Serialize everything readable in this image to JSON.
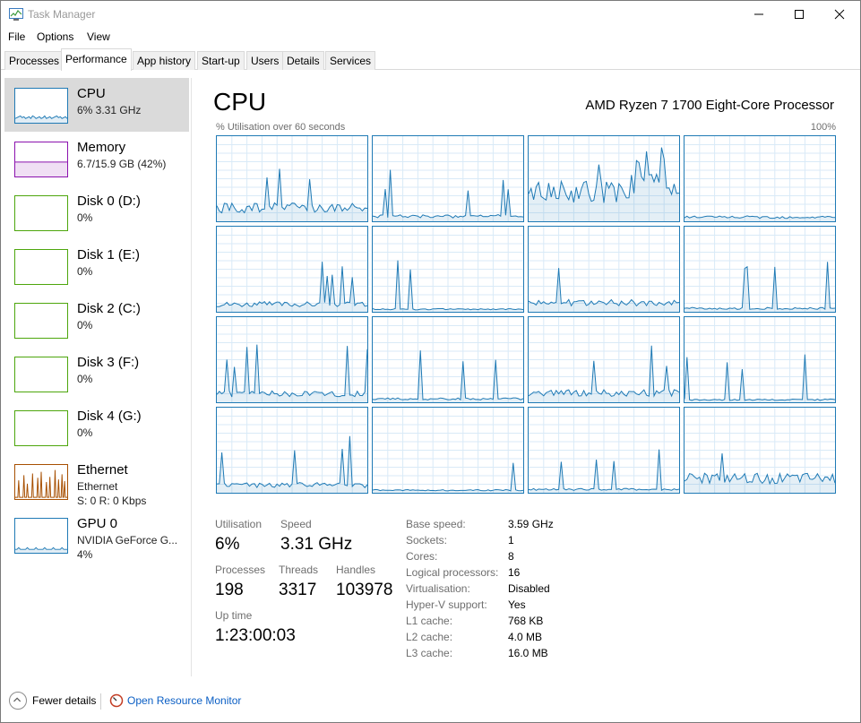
{
  "window": {
    "title": "Task Manager"
  },
  "menu": [
    "File",
    "Options",
    "View"
  ],
  "tabs": [
    "Processes",
    "Performance",
    "App history",
    "Start-up",
    "Users",
    "Details",
    "Services"
  ],
  "active_tab": "Performance",
  "sidebar": {
    "items": [
      {
        "name": "CPU",
        "sub1": "6% 3.31 GHz",
        "color": "#1f7ab5",
        "selected": true
      },
      {
        "name": "Memory",
        "sub1": "6.7/15.9 GB (42%)",
        "color": "#8b12ae"
      },
      {
        "name": "Disk 0 (D:)",
        "sub1": "0%",
        "color": "#4da60c"
      },
      {
        "name": "Disk 1 (E:)",
        "sub1": "0%",
        "color": "#4da60c"
      },
      {
        "name": "Disk 2 (C:)",
        "sub1": "0%",
        "color": "#4da60c"
      },
      {
        "name": "Disk 3 (F:)",
        "sub1": "0%",
        "color": "#4da60c"
      },
      {
        "name": "Disk 4 (G:)",
        "sub1": "0%",
        "color": "#4da60c"
      },
      {
        "name": "Ethernet",
        "sub1": "Ethernet",
        "sub2": "S: 0 R: 0 Kbps",
        "color": "#a74f01"
      },
      {
        "name": "GPU 0",
        "sub1": "NVIDIA GeForce G...",
        "sub2": "4%",
        "color": "#1f7ab5"
      }
    ]
  },
  "main": {
    "title": "CPU",
    "model": "AMD Ryzen 7 1700 Eight-Core Processor",
    "graph_label": "% Utilisation over 60 seconds",
    "graph_max": "100%",
    "accent": "#1f7ab5",
    "core_usage_levels": [
      0.15,
      0.05,
      0.35,
      0.04,
      0.08,
      0.02,
      0.1,
      0.03,
      0.09,
      0.03,
      0.1,
      0.02,
      0.08,
      0.02,
      0.03,
      0.16
    ]
  },
  "stats": {
    "utilisation_label": "Utilisation",
    "utilisation": "6%",
    "speed_label": "Speed",
    "speed": "3.31 GHz",
    "processes_label": "Processes",
    "processes": "198",
    "threads_label": "Threads",
    "threads": "3317",
    "handles_label": "Handles",
    "handles": "103978",
    "uptime_label": "Up time",
    "uptime": "1:23:00:03"
  },
  "specs": [
    {
      "label": "Base speed:",
      "value": "3.59 GHz"
    },
    {
      "label": "Sockets:",
      "value": "1"
    },
    {
      "label": "Cores:",
      "value": "8"
    },
    {
      "label": "Logical processors:",
      "value": "16"
    },
    {
      "label": "Virtualisation:",
      "value": "Disabled"
    },
    {
      "label": "Hyper-V support:",
      "value": "Yes"
    },
    {
      "label": "L1 cache:",
      "value": "768 KB"
    },
    {
      "label": "L2 cache:",
      "value": "4.0 MB"
    },
    {
      "label": "L3 cache:",
      "value": "16.0 MB"
    }
  ],
  "footer": {
    "fewer_details": "Fewer details",
    "resource_monitor": "Open Resource Monitor"
  }
}
